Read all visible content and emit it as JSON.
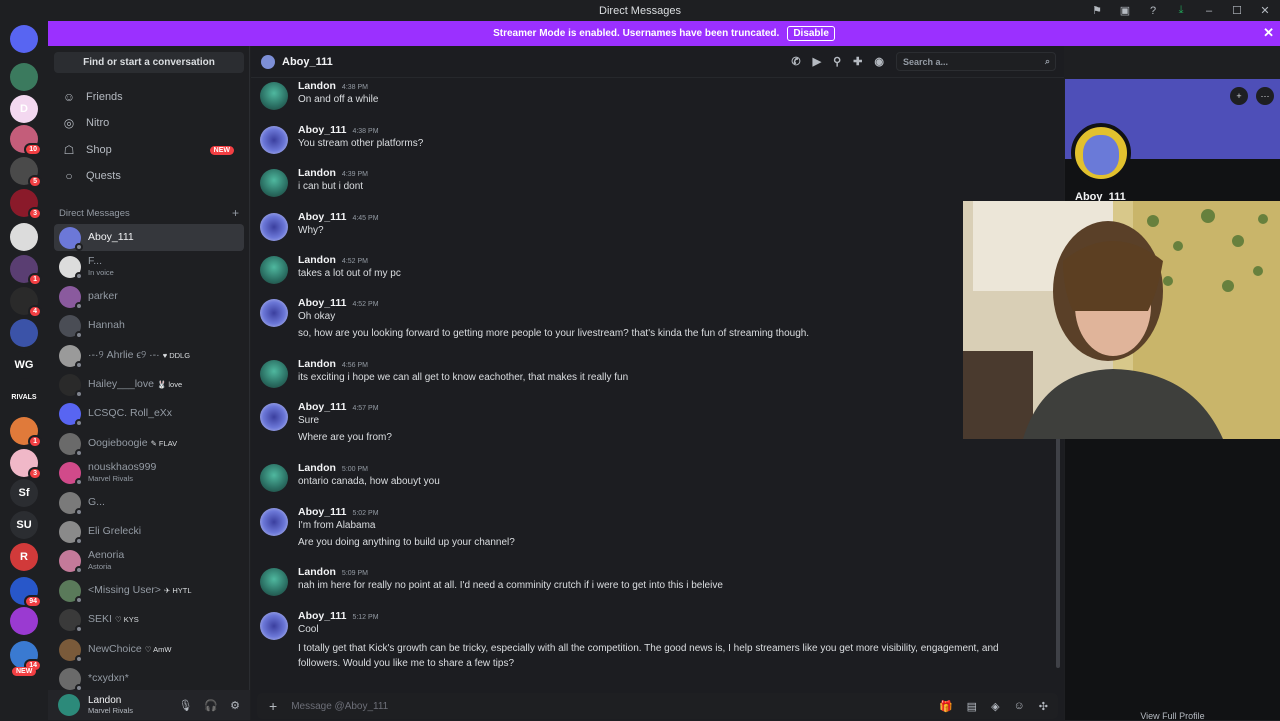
{
  "window": {
    "title": "Direct Messages"
  },
  "streamer_bar": {
    "text": "Streamer Mode is enabled. Usernames have been truncated.",
    "disable_label": "Disable"
  },
  "servers": [
    {
      "label": "",
      "badge": "",
      "color": "#5865f2",
      "icon": "discord-icon"
    },
    {
      "label": "",
      "badge": "",
      "color": "#3b7a5e"
    },
    {
      "label": "D",
      "badge": "",
      "color": "#f3d8f0"
    },
    {
      "label": "",
      "badge": "10",
      "color": "#c45d7a"
    },
    {
      "label": "",
      "badge": "5",
      "color": "#4a4a4a"
    },
    {
      "label": "",
      "badge": "3",
      "color": "#8a1a2a"
    },
    {
      "label": "",
      "badge": "",
      "color": "#dcdcdc"
    },
    {
      "label": "",
      "badge": "1",
      "color": "#5a3e72"
    },
    {
      "label": "",
      "badge": "4",
      "color": "#2a2a2a"
    },
    {
      "label": "",
      "badge": "",
      "color": "#3b53a8"
    },
    {
      "label": "WG",
      "badge": "",
      "color": "#1e1f22"
    },
    {
      "label": "RIVALS",
      "badge": "",
      "color": "#1e1f22"
    },
    {
      "label": "",
      "badge": "1",
      "color": "#e07a3a"
    },
    {
      "label": "",
      "badge": "3",
      "color": "#f0b8c8"
    },
    {
      "label": "Sf",
      "badge": "",
      "color": "#2b2d31"
    },
    {
      "label": "SU",
      "badge": "",
      "color": "#2b2d31"
    },
    {
      "label": "R",
      "badge": "",
      "color": "#d13a3a"
    },
    {
      "label": "",
      "badge": "94",
      "color": "#2857c9"
    },
    {
      "label": "",
      "badge": "",
      "color": "#9a3ad1"
    },
    {
      "label": "",
      "badge": "14",
      "color": "#3a7ad1"
    }
  ],
  "servers_new_badge": "NEW",
  "sidebar": {
    "find_label": "Find or start a conversation",
    "nav": [
      {
        "label": "Friends",
        "icon": "friends-icon",
        "glyph": "☺"
      },
      {
        "label": "Nitro",
        "icon": "nitro-icon",
        "glyph": "◎"
      },
      {
        "label": "Shop",
        "icon": "shop-icon",
        "glyph": "☖",
        "badge": "NEW"
      },
      {
        "label": "Quests",
        "icon": "quests-icon",
        "glyph": "○"
      }
    ],
    "dm_header": "Direct Messages",
    "dm_add": "+",
    "dms": [
      {
        "name": "Aboy_111",
        "sub": "",
        "tag": "",
        "color": "#6c78d8",
        "active": true
      },
      {
        "name": "F...",
        "sub": "In voice",
        "tag": "",
        "color": "#dcdcdc",
        "active": false
      },
      {
        "name": "parker",
        "sub": "",
        "tag": "",
        "color": "#8a5a9e",
        "active": false
      },
      {
        "name": "Hannah",
        "sub": "",
        "tag": "",
        "color": "#4a4d55",
        "active": false
      },
      {
        "name": "·-·୨ Аhrlie ϵ୨ ·-·",
        "sub": "",
        "tag": "♥ DDLG",
        "color": "#9a9a9a",
        "active": false
      },
      {
        "name": "Hailey___love",
        "sub": "",
        "tag": "🐰 love",
        "color": "#2a2a2a",
        "active": false
      },
      {
        "name": "LCSQC. Roll_eXx",
        "sub": "",
        "tag": "",
        "color": "#5865f2",
        "active": false
      },
      {
        "name": "Oogieboogie",
        "sub": "",
        "tag": "✎ FLAV",
        "color": "#6a6a6a",
        "active": false
      },
      {
        "name": "nouskhaos999",
        "sub": "Marvel Rivals",
        "tag": "",
        "color": "#d14a8a",
        "active": false
      },
      {
        "name": "G...",
        "sub": "",
        "tag": "",
        "color": "#7a7a7a",
        "active": false
      },
      {
        "name": "Eli Grelecki",
        "sub": "",
        "tag": "",
        "color": "#8a8a8a",
        "active": false
      },
      {
        "name": "Aenoria",
        "sub": "Astoria",
        "tag": "",
        "color": "#c47a9a",
        "active": false
      },
      {
        "name": "<Missing User>",
        "sub": "",
        "tag": "✈ HYTL",
        "color": "#5a7a5a",
        "active": false
      },
      {
        "name": "SEKI",
        "sub": "",
        "tag": "♡ KYS",
        "color": "#3a3a3a",
        "active": false
      },
      {
        "name": "NewChoice",
        "sub": "",
        "tag": "♡ AmW",
        "color": "#7a5a3a",
        "active": false
      },
      {
        "name": "*cxydxn*",
        "sub": "",
        "tag": "",
        "color": "#6a6a6a",
        "active": false
      }
    ]
  },
  "user_panel": {
    "name": "Landon",
    "status": "Marvel Rivals"
  },
  "chat": {
    "recipient": "Aboy_111",
    "search_placeholder": "Search a...",
    "composer_placeholder": "Message @Aboy_111",
    "messages": [
      {
        "author": "Landon",
        "time": "4:38 PM",
        "lines": [
          "On and off a while"
        ]
      },
      {
        "author": "Aboy_111",
        "time": "4:38 PM",
        "lines": [
          "You stream other platforms?"
        ]
      },
      {
        "author": "Landon",
        "time": "4:39 PM",
        "lines": [
          "i can but i dont"
        ]
      },
      {
        "author": "Aboy_111",
        "time": "4:45 PM",
        "lines": [
          "Why?"
        ]
      },
      {
        "author": "Landon",
        "time": "4:52 PM",
        "lines": [
          "takes a lot out of my pc"
        ]
      },
      {
        "author": "Aboy_111",
        "time": "4:52 PM",
        "lines": [
          "Oh okay",
          "so, how are you looking forward to getting more people to your livestream? that's kinda the fun of streaming though."
        ]
      },
      {
        "author": "Landon",
        "time": "4:56 PM",
        "lines": [
          "its exciting i hope we can all get to know eachother, that makes it really fun"
        ]
      },
      {
        "author": "Aboy_111",
        "time": "4:57 PM",
        "lines": [
          "Sure",
          "Where are you from?"
        ]
      },
      {
        "author": "Landon",
        "time": "5:00 PM",
        "lines": [
          "ontario canada, how abouyt you"
        ]
      },
      {
        "author": "Aboy_111",
        "time": "5:02 PM",
        "lines": [
          "I'm from Alabama",
          "Are you doing anything to build up your channel?"
        ]
      },
      {
        "author": "Landon",
        "time": "5:09 PM",
        "lines": [
          "nah im here for really no point at all. I'd need a comminity crutch if i were to get into this i beleive"
        ]
      },
      {
        "author": "Aboy_111",
        "time": "5:12 PM",
        "lines": [
          "Cool",
          "I totally get that Kick's growth can be tricky, especially with all the competition. The good news is, I help streamers like you get more visibility, engagement, and followers. Would you like me to share a few tips?"
        ]
      }
    ]
  },
  "profile": {
    "name": "Aboy_111",
    "view_full": "View Full Profile"
  }
}
